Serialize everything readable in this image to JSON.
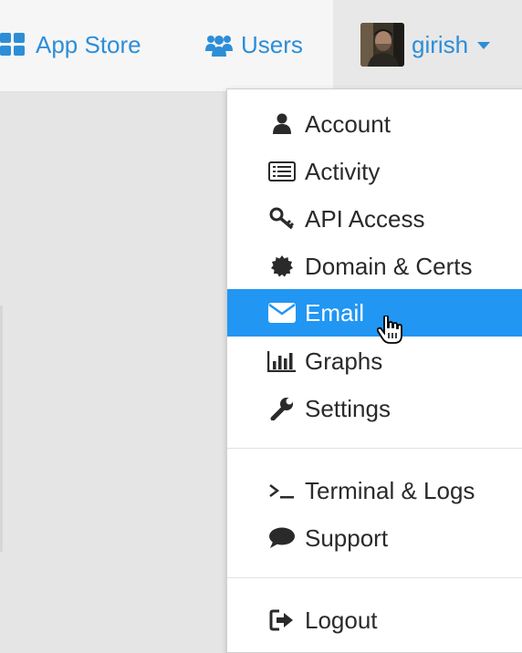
{
  "colors": {
    "accent": "#2d8ed8",
    "active_bg": "#2196f3",
    "text": "#2a2a2a"
  },
  "navbar": {
    "app_store": {
      "label": "App Store",
      "icon": "grid-icon"
    },
    "users": {
      "label": "Users",
      "icon": "users-icon"
    },
    "profile": {
      "username": "girish",
      "icon": "caret-down-icon"
    }
  },
  "menu": {
    "items": [
      {
        "label": "Account",
        "icon": "user-icon"
      },
      {
        "label": "Activity",
        "icon": "list-icon"
      },
      {
        "label": "API Access",
        "icon": "key-icon"
      },
      {
        "label": "Domain & Certs",
        "icon": "certificate-icon"
      },
      {
        "label": "Email",
        "icon": "envelope-icon",
        "active": true
      },
      {
        "label": "Graphs",
        "icon": "bar-chart-icon"
      },
      {
        "label": "Settings",
        "icon": "wrench-icon"
      },
      {
        "label": "Terminal & Logs",
        "icon": "terminal-icon"
      },
      {
        "label": "Support",
        "icon": "comment-icon"
      },
      {
        "label": "Logout",
        "icon": "sign-out-icon"
      }
    ]
  }
}
